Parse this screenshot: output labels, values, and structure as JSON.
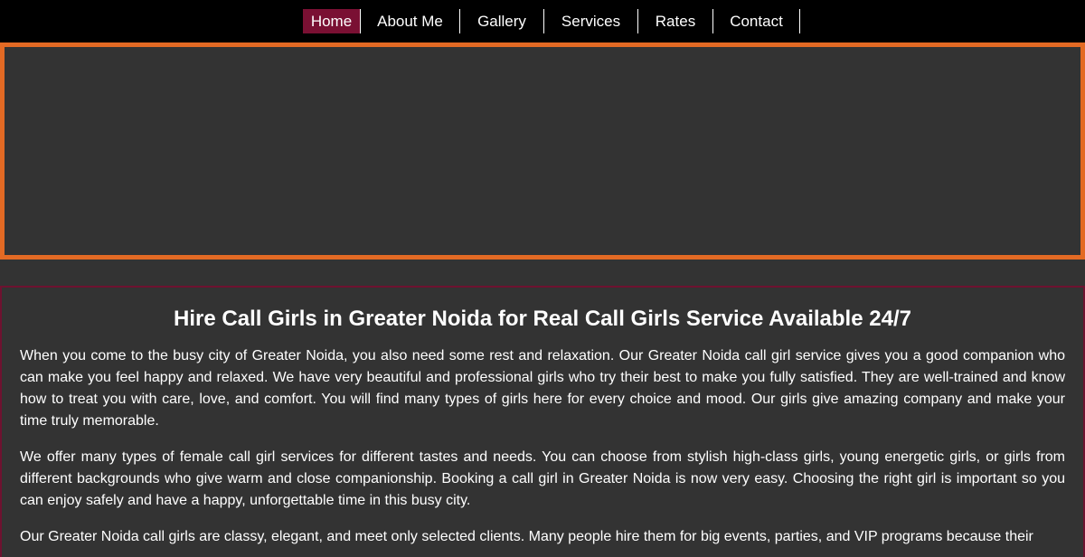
{
  "nav": {
    "items": [
      {
        "label": "Home",
        "active": true
      },
      {
        "label": "About Me",
        "active": false
      },
      {
        "label": "Gallery",
        "active": false
      },
      {
        "label": "Services",
        "active": false
      },
      {
        "label": "Rates",
        "active": false
      },
      {
        "label": "Contact",
        "active": false
      }
    ]
  },
  "colors": {
    "nav_background": "#000000",
    "active_item": "#7a1033",
    "hero_border": "#e36a24",
    "content_border": "#6e1230",
    "page_background": "#333333"
  },
  "content": {
    "title": "Hire Call Girls in Greater Noida for Real Call Girls Service Available 24/7",
    "paragraphs": [
      "When you come to the busy city of Greater Noida, you also need some rest and relaxation. Our Greater Noida call girl service gives you a good companion who can make you feel happy and relaxed. We have very beautiful and professional girls who try their best to make you fully satisfied. They are well-trained and know how to treat you with care, love, and comfort. You will find many types of girls here for every choice and mood. Our girls give amazing company and make your time truly memorable.",
      "We offer many types of female call girl services for different tastes and needs. You can choose from stylish high-class girls, young energetic girls, or girls from different backgrounds who give warm and close companionship. Booking a call girl in Greater Noida is now very easy. Choosing the right girl is important so you can enjoy safely and have a happy, unforgettable time in this busy city.",
      "Our Greater Noida call girls are classy, elegant, and meet only selected clients. Many people hire them for big events, parties, and VIP programs because their"
    ]
  }
}
